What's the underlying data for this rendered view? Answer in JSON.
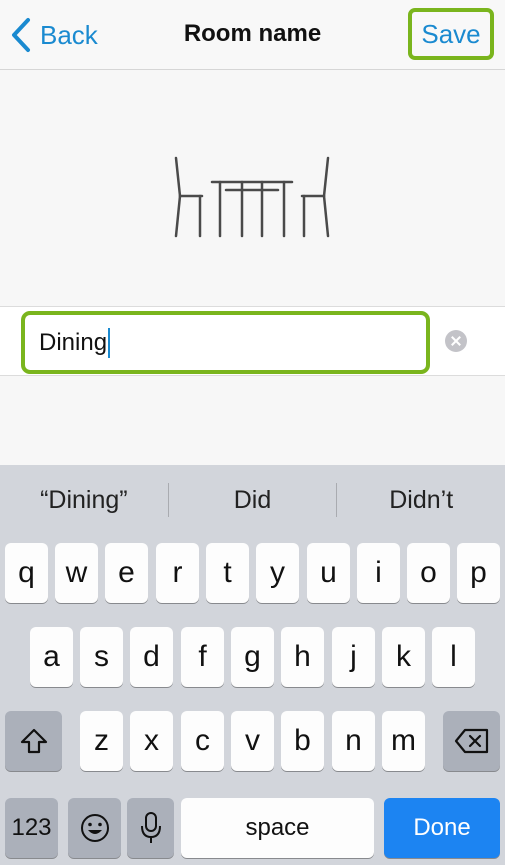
{
  "nav": {
    "back_label": "Back",
    "title": "Room name",
    "save_label": "Save"
  },
  "room_icon": "dining-table-icon",
  "name_input": {
    "value": "Dining"
  },
  "colors": {
    "accent_blue": "#1a8ad0",
    "highlight_green": "#7ab51d",
    "done_blue": "#1c84f2"
  },
  "keyboard": {
    "suggestions": [
      "“Dining”",
      "Did",
      "Didn’t"
    ],
    "row1": [
      "q",
      "w",
      "e",
      "r",
      "t",
      "y",
      "u",
      "i",
      "o",
      "p"
    ],
    "row2": [
      "a",
      "s",
      "d",
      "f",
      "g",
      "h",
      "j",
      "k",
      "l"
    ],
    "row3": [
      "z",
      "x",
      "c",
      "v",
      "b",
      "n",
      "m"
    ],
    "numbers_label": "123",
    "space_label": "space",
    "done_label": "Done",
    "shift_icon": "shift-icon",
    "delete_icon": "backspace-icon",
    "emoji_icon": "emoji-icon",
    "mic_icon": "microphone-icon"
  }
}
